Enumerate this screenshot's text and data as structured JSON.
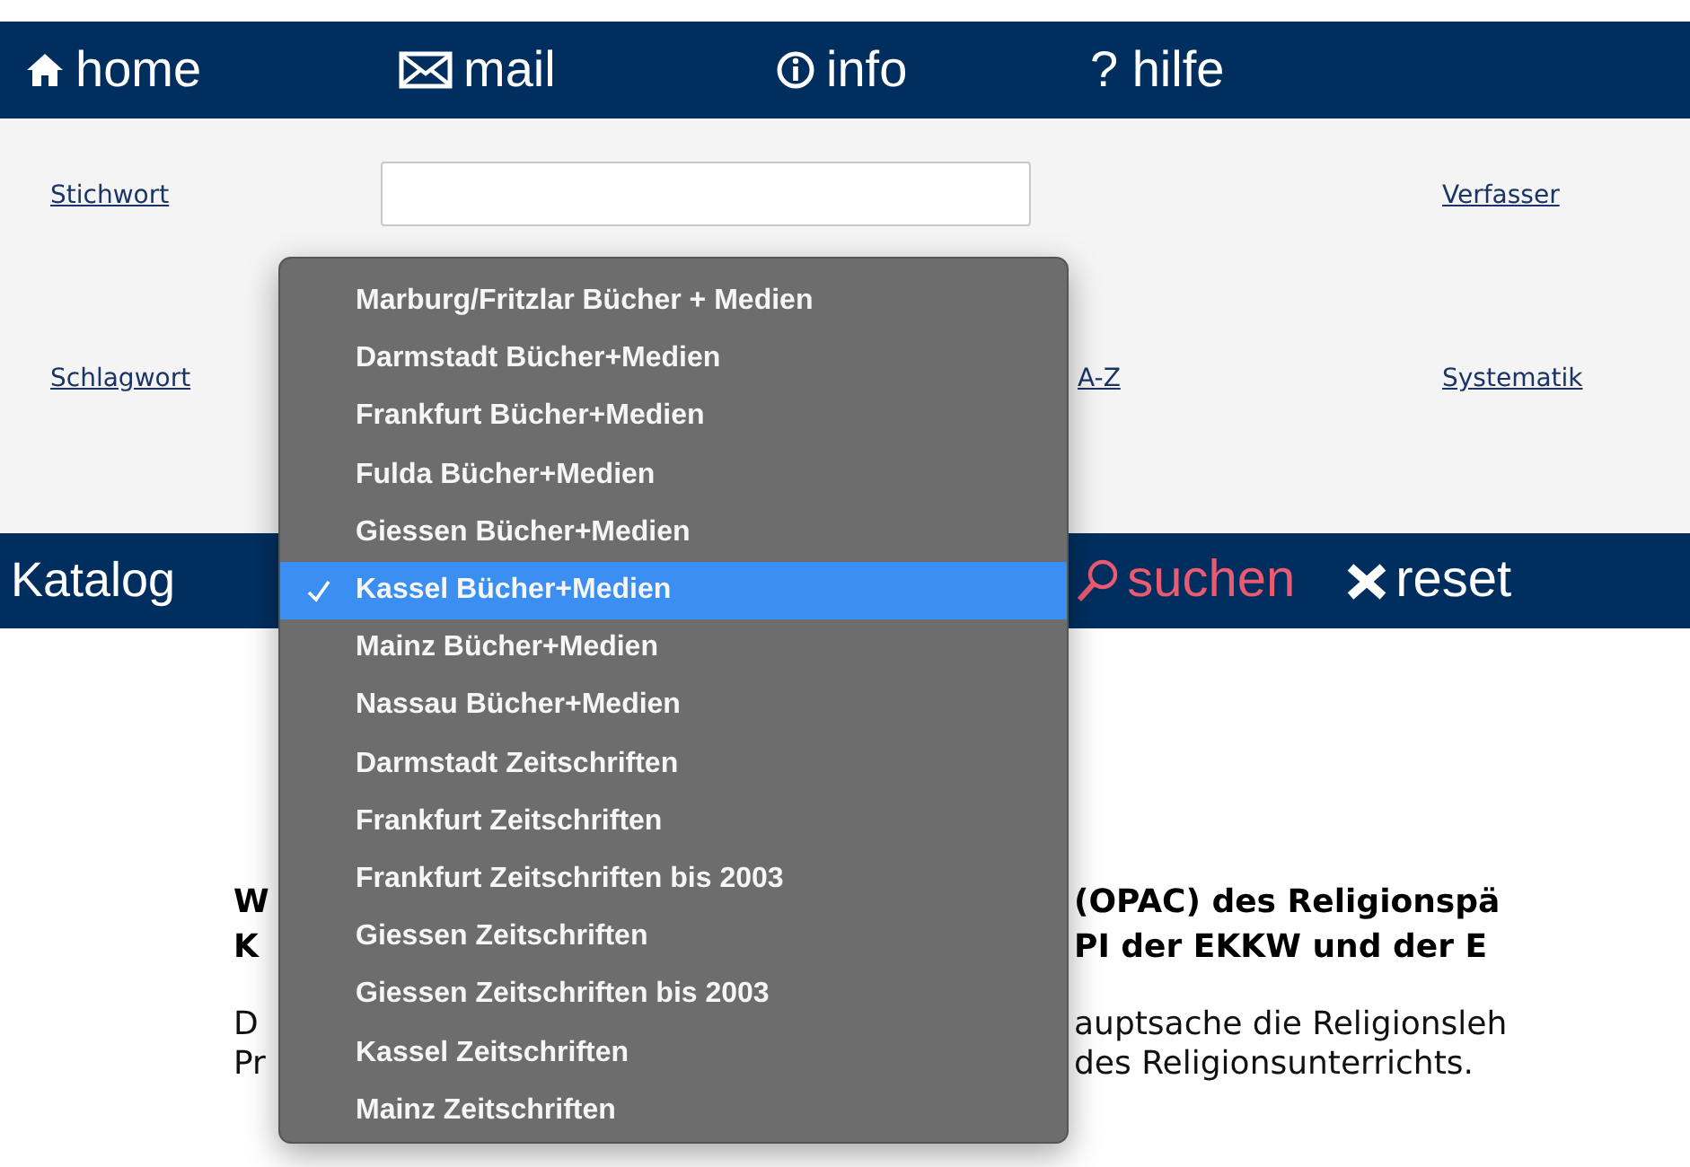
{
  "nav": [
    {
      "label": "home"
    },
    {
      "label": "mail"
    },
    {
      "label": "info"
    },
    {
      "label": "? hilfe"
    }
  ],
  "search_rows": [
    {
      "kind": "text-input",
      "label": "Stichwort",
      "right_link": "Verfasser"
    },
    {
      "kind": "select",
      "label": "Schlagwort",
      "middle_link": "A-Z",
      "right_link": "Systematik"
    }
  ],
  "catalog_bar": {
    "label": "Katalog",
    "search_button": "suchen",
    "reset_button": "reset"
  },
  "content": {
    "heading_lines": [
      [
        "W",
        "(OPAC) des Religionspä"
      ],
      [
        "K",
        "PI der EKKW und der E"
      ]
    ],
    "paragraph_lines": [
      [
        "D",
        "auptsache die Religionsleh"
      ],
      [
        "Pr",
        "des Religionsunterrichts."
      ]
    ]
  },
  "dropdown": {
    "options": [
      {
        "label": "Marburg/Fritzlar Bücher + Medien",
        "selected": false
      },
      {
        "label": "Darmstadt Bücher+Medien",
        "selected": false
      },
      {
        "label": "Frankfurt Bücher+Medien",
        "selected": false
      },
      {
        "label": "Fulda Bücher+Medien",
        "selected": false
      },
      {
        "label": "Giessen Bücher+Medien",
        "selected": false
      },
      {
        "label": "Kassel Bücher+Medien",
        "selected": true
      },
      {
        "label": "Mainz Bücher+Medien",
        "selected": false
      },
      {
        "label": "Nassau Bücher+Medien",
        "selected": false
      },
      {
        "label": "Darmstadt Zeitschriften",
        "selected": false
      },
      {
        "label": "Frankfurt Zeitschriften",
        "selected": false
      },
      {
        "label": "Frankfurt Zeitschriften bis 2003",
        "selected": false
      },
      {
        "label": "Giessen Zeitschriften",
        "selected": false
      },
      {
        "label": "Giessen Zeitschriften bis 2003",
        "selected": false
      },
      {
        "label": "Kassel Zeitschriften",
        "selected": false
      },
      {
        "label": "Mainz Zeitschriften",
        "selected": false
      }
    ]
  }
}
